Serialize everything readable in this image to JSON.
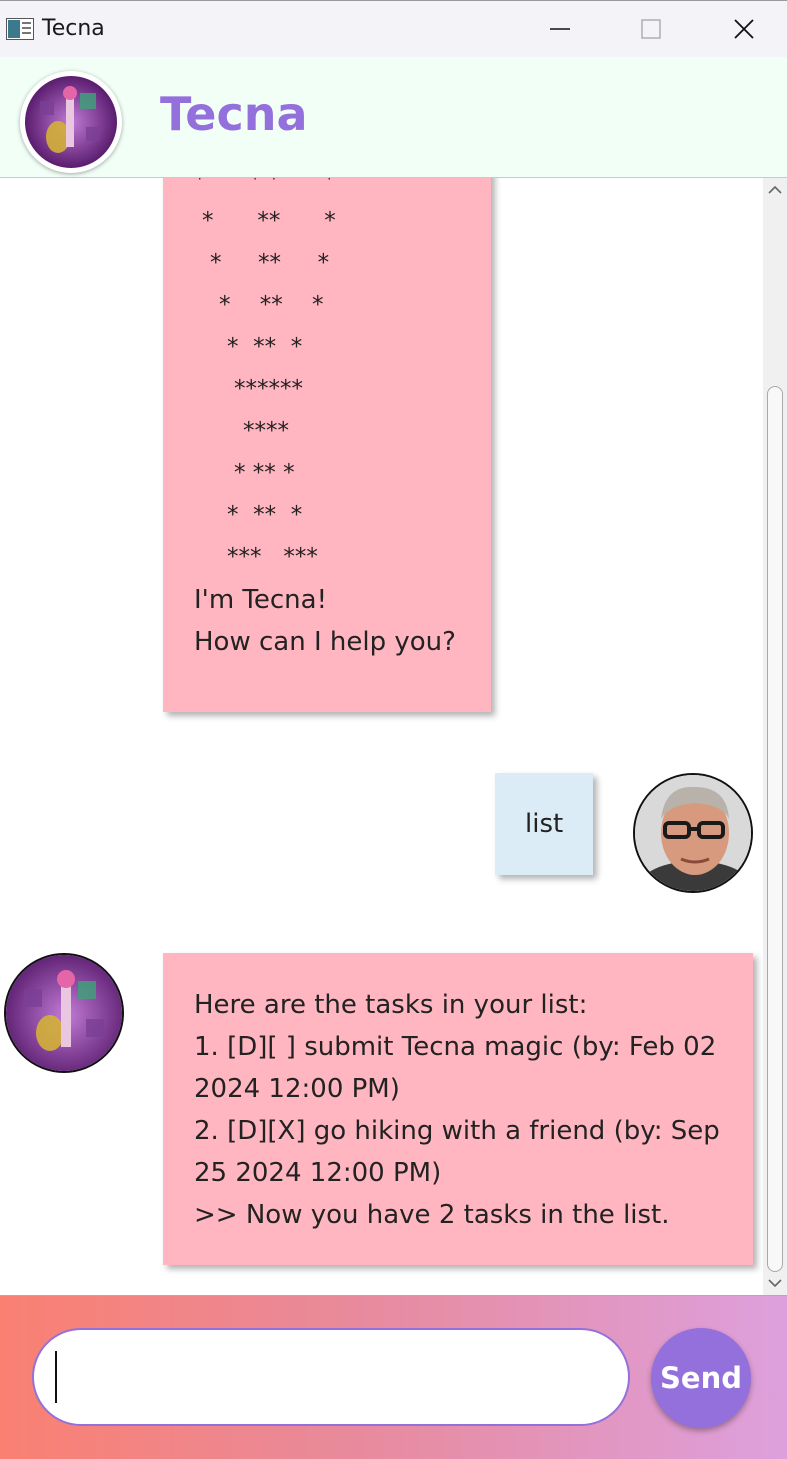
{
  "window": {
    "title": "Tecna",
    "icon": "app-window-icon"
  },
  "header": {
    "title": "Tecna",
    "avatar": "tecna-avatar"
  },
  "messages": {
    "greeting": {
      "ascii_art": [
        "*      * *      *",
        "*      **      *",
        "*     **     *",
        "*    **    *",
        "*  **  *",
        "******",
        "****",
        "* ** *",
        "*  **  *",
        "***   ***"
      ],
      "lines": [
        "I'm Tecna!",
        "How can I help you?"
      ]
    },
    "user_command": {
      "text": "list"
    },
    "list_response": {
      "lines": [
        "Here are the tasks in your list:",
        "1. [D][ ] submit Tecna magic (by: Feb 02",
        "2024 12:00 PM)",
        "2. [D][X] go hiking with a friend (by: Sep",
        "25 2024 12:00 PM)",
        ">> Now you have 2 tasks in the list."
      ]
    }
  },
  "input": {
    "value": "",
    "placeholder": ""
  },
  "send_button": {
    "label": "Send"
  },
  "colors": {
    "accent": "#9370db",
    "bot_bubble": "#ffb6c1",
    "user_bubble": "#dbecf7",
    "header_bg": "#f2fff7",
    "input_gradient_start": "#fa8072",
    "input_gradient_end": "#dda0dd"
  }
}
